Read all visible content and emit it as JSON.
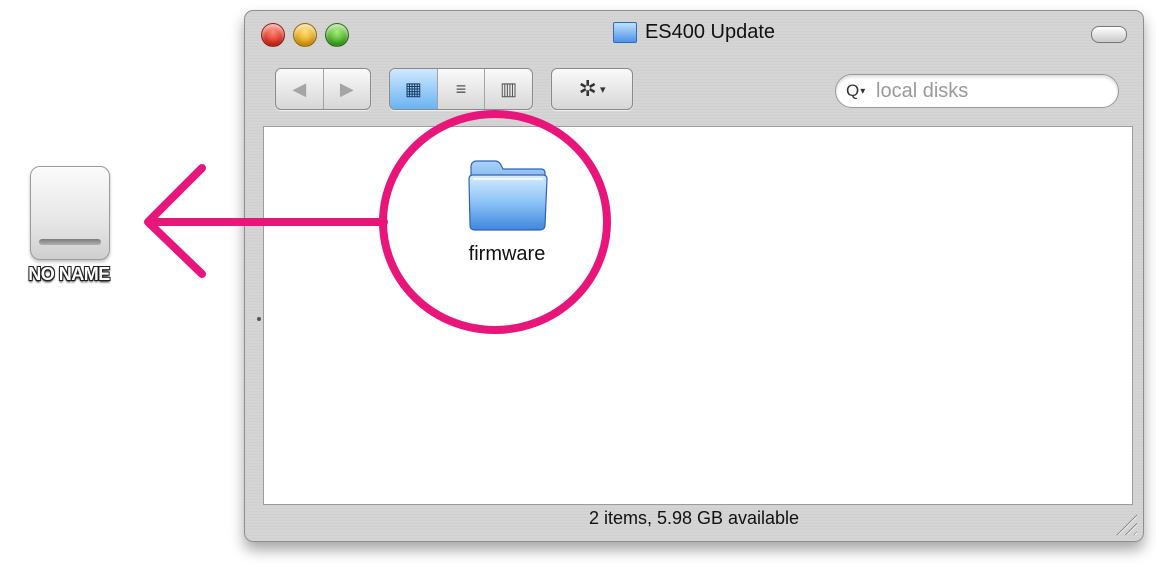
{
  "desktop": {
    "drive": {
      "label": "NO NAME",
      "icon": "external-drive-icon"
    }
  },
  "window": {
    "title": "ES400 Update",
    "title_icon": "folder-icon",
    "toolbar": {
      "back_icon": "◀",
      "forward_icon": "▶",
      "views": [
        {
          "name": "icon-view",
          "glyph": "▦",
          "active": true
        },
        {
          "name": "list-view",
          "glyph": "≡",
          "active": false
        },
        {
          "name": "column-view",
          "glyph": "▥",
          "active": false
        }
      ],
      "action_glyph": "✲",
      "action_caret": "▾"
    },
    "search": {
      "value": "local disks",
      "icon_glyph": "Q",
      "icon_caret": "▾"
    },
    "items": [
      {
        "label": "firmware",
        "icon": "folder-icon"
      }
    ],
    "status": "2 items, 5.98 GB available"
  },
  "colors": {
    "annotation": "#e8157a",
    "folder_blue": "#4d93e8",
    "active_view": "#6ab3f1"
  }
}
